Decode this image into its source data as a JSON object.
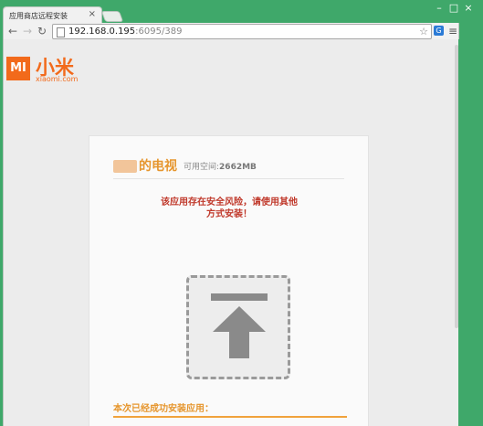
{
  "browser": {
    "tab": {
      "title": "应用商店远程安装",
      "close": "×"
    },
    "window_controls": {
      "minimize": "–",
      "maximize": "□",
      "close": "×"
    },
    "nav": {
      "back": "←",
      "forward": "→",
      "reload": "↻"
    },
    "address": {
      "host": "192.168.0.195",
      "rest": ":6095/389"
    },
    "star": "☆",
    "menu": "≡"
  },
  "site": {
    "logo_mark": "MI",
    "logo_name": "小米",
    "logo_domain": "xiaomi.com"
  },
  "card": {
    "device_name": "的电视",
    "space_label": "可用空间:",
    "space_value": "2662MB",
    "warning": "该应用存在安全风险，请使用其他方式安装！",
    "success": "本次已经成功安装应用："
  },
  "colors": {
    "brand": "#f26a1b",
    "frame": "#3fa86a",
    "warning": "#c0392b",
    "accent": "#e6962e"
  }
}
